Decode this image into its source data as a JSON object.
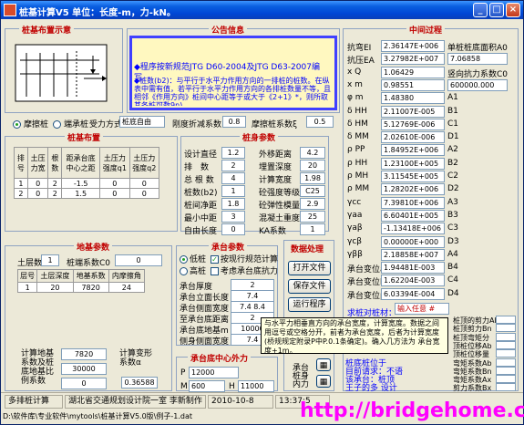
{
  "window": {
    "title": "桩基计算V5   单位：长度-m，力-kN。"
  },
  "layout_panel": {
    "title": "桩基布置示意"
  },
  "notice_panel": {
    "title": "公告信息",
    "line1": "◆程序按新规范JTG D60-2004及JTG D63-2007编写。",
    "line2": "◆桩数(b2)：与平行于水平力作用方向的一排桩的桩数。在纵表中需有值，若平行于水平力作用方向的各排桩数量不等，且相邻《作用方向》桩间中心距等于或大于《2+1》*，则所取其各桩可数9n)",
    "line3": "~~ 相邻桩排中心距h1，且取相邻《2.1》*，其值按桩数量多的"
  },
  "pile_type": {
    "friction_label": "摩擦桩",
    "end_label": "端承桩",
    "force_mode_label": "受力方式",
    "force_mode_value": "桩底自由",
    "rigid_coef_label": "刚度折减系数",
    "rigid_coef_value": "0.8",
    "friction_coef_label": "摩擦桩系数ξ",
    "friction_coef_value": "0.5"
  },
  "pile_layout": {
    "title": "桩基布置",
    "headers": [
      "排号",
      "土压力宽",
      "根数",
      "距承台底中心之距",
      "土压力强度q1",
      "土压力强度q2"
    ],
    "rows": [
      [
        "1",
        "0",
        "2",
        "-1.5",
        "0",
        "0"
      ],
      [
        "2",
        "0",
        "2",
        "1.5",
        "0",
        "0"
      ]
    ]
  },
  "pile_params": {
    "title": "桩身参数",
    "fields": [
      {
        "label": "设计直径",
        "value": "1.2",
        "label2": "外移距离",
        "value2": "4.2"
      },
      {
        "label": "排　数",
        "value": "2",
        "label2": "埋置深度",
        "value2": "20"
      },
      {
        "label": "总 根 数",
        "value": "4",
        "label2": "计算宽度",
        "value2": "1.98"
      },
      {
        "label": "桩数(b2)",
        "value": "1",
        "label2": "砼强度等级",
        "value2": "C25"
      },
      {
        "label": "桩间净距",
        "value": "1.8",
        "label2": "砼弹性模量",
        "value2": "2.9"
      },
      {
        "label": "最小中距",
        "value": "3",
        "label2": "混凝土重度",
        "value2": "25"
      },
      {
        "label": "自由长度",
        "value": "0",
        "label2": "KA系数",
        "value2": "1"
      }
    ]
  },
  "foundation": {
    "title": "地基参数",
    "soil_layers_label": "土层数",
    "soil_layers_value": "1",
    "cap_coef_label": "桩端系数C0",
    "cap_coef_value": "0",
    "headers": [
      "层号",
      "土层深度",
      "地基系数",
      "内摩擦角"
    ],
    "rows": [
      [
        "1",
        "20",
        "7820",
        "24"
      ]
    ],
    "bottom_labels": {
      "calc_coef": "计算地基系数及桩底地基比例系数",
      "values": [
        "7820",
        "30000",
        "0"
      ],
      "deform_label": "计算变形系数α",
      "deform_value": "0.36588"
    }
  },
  "cap_params": {
    "title": "承台参数",
    "low_label": "低桩",
    "high_label": "高桩",
    "chk1_label": "按现行规范计算",
    "chk2_label": "考虑承台底抗力",
    "fields": [
      {
        "label": "承台厚度",
        "value": "2"
      },
      {
        "label": "承台立面长度",
        "value": "7.4"
      },
      {
        "label": "承台侧面宽度",
        "value": "7.4 8.4"
      },
      {
        "label": "至承台底距离",
        "value": "2"
      },
      {
        "label": "承台底地基m",
        "value": "10000"
      },
      {
        "label": "侧身侧面宽度",
        "value": "7.4"
      }
    ]
  },
  "cap_external": {
    "title": "承台底中心外力",
    "p_label": "P",
    "p_value": "12000",
    "m_label": "M",
    "m_value": "600",
    "h_label": "H",
    "h_value": "11000"
  },
  "data_processing": {
    "title": "数据处理",
    "open": "打开文件",
    "save": "保存文件",
    "run": "运行程序",
    "calc_label1": "承台",
    "calc_label2": "桩身\n内力"
  },
  "middle_process": {
    "title": "中间过程",
    "rows": [
      {
        "l": "抗弯EI",
        "v": "2.36147E+006",
        "r": "单桩桩底面积A0"
      },
      {
        "l": "抗压EA",
        "v": "3.27982E+007",
        "rv": "7.06858"
      },
      {
        "l": "x Q",
        "v": "1.06429",
        "r": "竖向抗力系数C0"
      },
      {
        "l": "x m",
        "v": "0.98551",
        "rv": "600000.000"
      },
      {
        "l": "φ m",
        "v": "1.48380",
        "r": "A1"
      },
      {
        "l": "δ HH",
        "v": "2.11007E-005",
        "r": "B1"
      },
      {
        "l": "δ HM",
        "v": "5.12769E-006",
        "r": "C1"
      },
      {
        "l": "δ MM",
        "v": "2.02610E-006",
        "r": "D1"
      },
      {
        "l": "ρ PP",
        "v": "1.84952E+006",
        "r": "A2"
      },
      {
        "l": "ρ HH",
        "v": "1.23100E+005",
        "r": "B2"
      },
      {
        "l": "ρ MH",
        "v": "3.11545E+005",
        "r": "C2"
      },
      {
        "l": "ρ MM",
        "v": "1.28202E+006",
        "r": "D2"
      },
      {
        "l": "γcc",
        "v": "7.39810E+006",
        "r": "A3"
      },
      {
        "l": "γaa",
        "v": "6.60401E+005",
        "r": "B3"
      },
      {
        "l": "γaβ",
        "v": "-1.13418E+006",
        "r": "C3"
      },
      {
        "l": "γcβ",
        "v": "0.00000E+000",
        "r": "D3"
      },
      {
        "l": "γββ",
        "v": "2.18858E+007",
        "r": "A4"
      },
      {
        "l": "承台变位a",
        "v": "1.94481E-003",
        "r": "B4"
      },
      {
        "l": "承台变位b",
        "v": "1.62204E-003",
        "r": "C4"
      },
      {
        "l": "承台变位β",
        "v": "6.03394E-004",
        "r": "D4"
      }
    ],
    "pile_force_label": "求桩对桩材：",
    "input_prompt": "输入任意 #",
    "extra_rows": [
      "桩顶的剪力Ab",
      "桩顶剪力Bn",
      "桩顶弯矩分",
      "顶桩位移Ab",
      "顶桩位移量",
      "弯矩系数Ab",
      "弯矩系数Bn",
      "弯矩系数Ax",
      "剪力系数Bx"
    ]
  },
  "tooltip": {
    "text": "与水平力相垂直方向的承台宽度，计算宽度。数据之间用逗号或空格分开，前者为承台宽度，后者为计算宽度(桥规规定附录P中P.0.1条确定)。确入几方法为 承台宽度+1m。"
  },
  "right_notes": {
    "line1": "桩底桩位于",
    "line2": "目前请求：不语",
    "line3": "该承台：桩顶",
    "line4": "王子的多 设计",
    "line5": "用来此刻"
  },
  "statusbar": {
    "cell1": "多排桩计算",
    "cell2": "湖北省交通规划设计院一室 李新制作",
    "cell3": "2010-10-8",
    "cell4": "13:37:5"
  },
  "path": "D:\\软件库\\专业软件\\mytools\\桩基计算V5.0版\\例子-1.dat",
  "watermark": "http://bridgehome.cn",
  "colors": {
    "title_red": "#c00000",
    "accent_blue": "#0046d5",
    "note_blue": "#0000ff",
    "watermark": "#ff00ff"
  }
}
